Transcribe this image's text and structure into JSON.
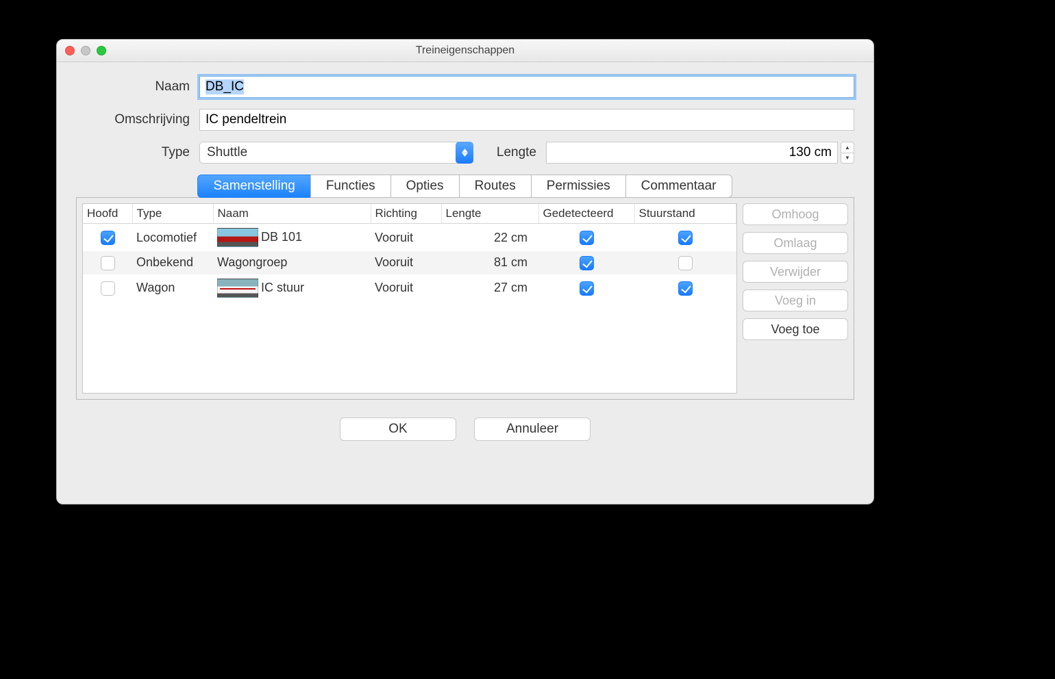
{
  "window": {
    "title": "Treineigenschappen"
  },
  "labels": {
    "name": "Naam",
    "description": "Omschrijving",
    "type": "Type",
    "length": "Lengte"
  },
  "fields": {
    "name": "DB_IC",
    "description": "IC pendeltrein",
    "type": "Shuttle",
    "length": "130 cm"
  },
  "tabs": [
    "Samenstelling",
    "Functies",
    "Opties",
    "Routes",
    "Permissies",
    "Commentaar"
  ],
  "active_tab": 0,
  "table": {
    "headers": [
      "Hoofd",
      "Type",
      "Naam",
      "Richting",
      "Lengte",
      "Gedetecteerd",
      "Stuurstand"
    ],
    "rows": [
      {
        "hoofd": true,
        "type": "Locomotief",
        "icon": "loco-red",
        "naam": "DB 101",
        "richting": "Vooruit",
        "lengte": "22 cm",
        "gedetecteerd": true,
        "stuurstand": true
      },
      {
        "hoofd": false,
        "type": "Onbekend",
        "icon": "",
        "naam": "Wagongroep",
        "richting": "Vooruit",
        "lengte": "81 cm",
        "gedetecteerd": true,
        "stuurstand": false
      },
      {
        "hoofd": false,
        "type": "Wagon",
        "icon": "wagon-white",
        "naam": "IC stuur",
        "richting": "Vooruit",
        "lengte": "27 cm",
        "gedetecteerd": true,
        "stuurstand": true
      }
    ]
  },
  "side_buttons": {
    "up": "Omhoog",
    "down": "Omlaag",
    "delete": "Verwijder",
    "insert": "Voeg in",
    "add": "Voeg toe"
  },
  "footer": {
    "ok": "OK",
    "cancel": "Annuleer"
  }
}
